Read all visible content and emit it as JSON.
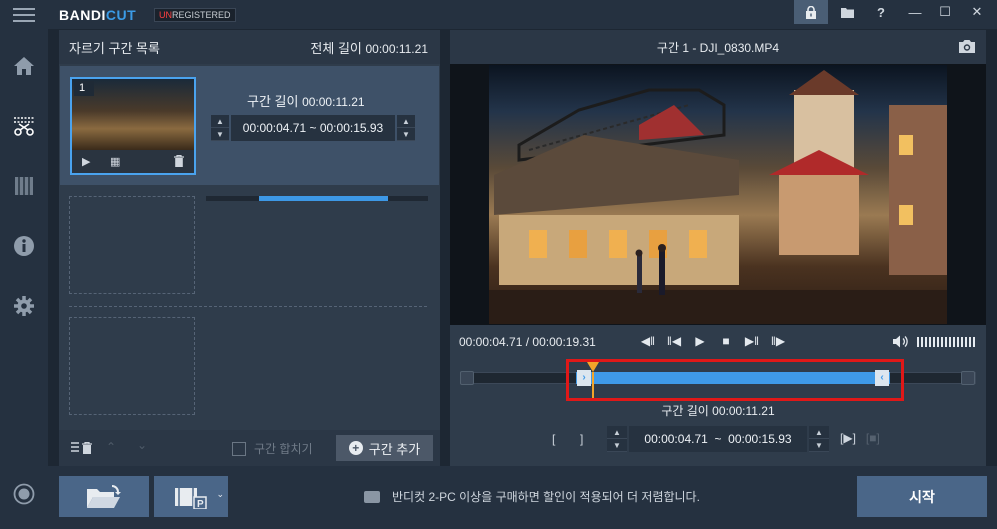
{
  "app": {
    "brand_a": "BANDI",
    "brand_b": "CUT",
    "unreg_a": "UN",
    "unreg_b": "REGISTERED"
  },
  "titlebar": {
    "lock_icon": "lock-icon",
    "folder_icon": "folder-icon",
    "help_label": "?",
    "minimize_label": "—",
    "maximize_label": "☐",
    "close_label": "✕"
  },
  "sidebar": {
    "items": [
      {
        "name": "home",
        "icon": "home-icon"
      },
      {
        "name": "cut",
        "icon": "scissors-icon"
      },
      {
        "name": "merge",
        "icon": "film-icon"
      },
      {
        "name": "info",
        "icon": "info-icon"
      },
      {
        "name": "settings",
        "icon": "gear-icon"
      },
      {
        "name": "record",
        "icon": "record-icon"
      }
    ]
  },
  "segment_list": {
    "title": "자르기 구간 목록",
    "total_label": "전체 길이",
    "total_time": "00:00:11.21",
    "clips": [
      {
        "number": "1",
        "length_label": "구간 길이",
        "length_time": "00:00:11.21",
        "range": "00:00:04.71 ~ 00:00:15.93",
        "progress_start": 0.24,
        "progress_end": 0.82
      }
    ],
    "merge_label": "구간 합치기",
    "add_label": "구간 추가"
  },
  "player": {
    "title": "구간 1 - DJI_0830.MP4",
    "current_time": "00:00:04.71",
    "duration": "00:00:19.31",
    "segment_length_label": "구간 길이",
    "segment_length": "00:00:11.21",
    "start_time": "00:00:04.71",
    "tilde": "~",
    "end_time": "00:00:15.93",
    "mark_in": "[",
    "mark_out": "]",
    "play_segment": "[▶]"
  },
  "bottom": {
    "promo_text": "반디컷 2-PC 이상을 구매하면 할인이 적용되어 더 저렴합니다.",
    "start_label": "시작"
  }
}
